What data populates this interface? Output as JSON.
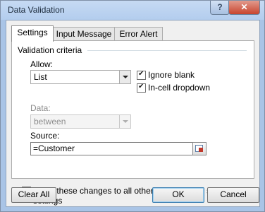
{
  "window": {
    "title": "Data Validation",
    "help_label": "?",
    "close_label": "✕"
  },
  "tabs": [
    {
      "label": "Settings",
      "active": true
    },
    {
      "label": "Input Message",
      "active": false
    },
    {
      "label": "Error Alert",
      "active": false
    }
  ],
  "settings": {
    "section_title": "Validation criteria",
    "allow_label": "Allow:",
    "allow_value": "List",
    "ignore_blank_label": "Ignore blank",
    "ignore_blank_checked": true,
    "in_cell_dropdown_label": "In-cell dropdown",
    "in_cell_dropdown_checked": true,
    "data_label": "Data:",
    "data_value": "between",
    "source_label": "Source:",
    "source_value": "=Customer",
    "apply_label": "Apply these changes to all other cells with the same settings",
    "apply_checked": false
  },
  "buttons": {
    "clear_all": "Clear All",
    "ok": "OK",
    "cancel": "Cancel"
  },
  "colors": {
    "title_bar": "#b3cdee",
    "close_button": "#c8452f"
  }
}
